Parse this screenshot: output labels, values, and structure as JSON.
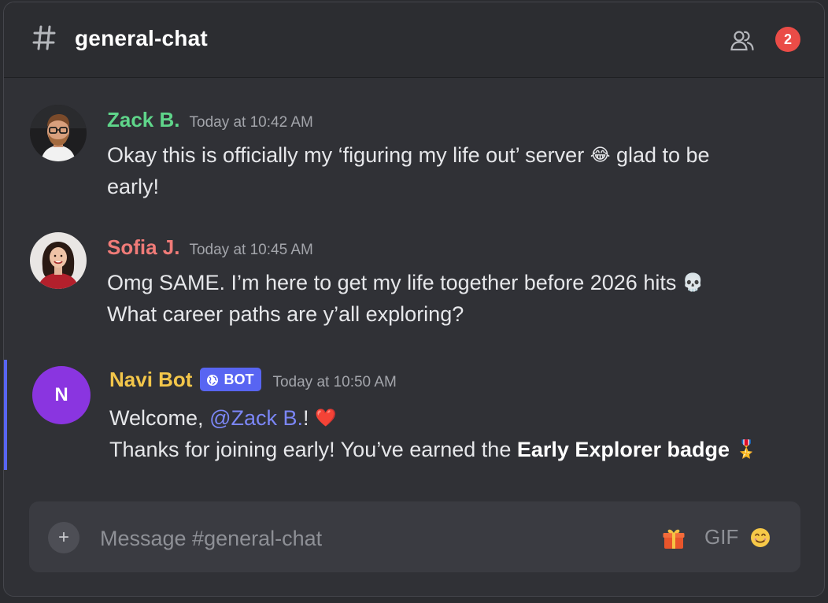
{
  "header": {
    "channel_name": "general-chat",
    "notification_count": "2"
  },
  "messages": [
    {
      "author": "Zack B.",
      "author_color": "#5fd58a",
      "timestamp": "Today at 10:42 AM",
      "line1": "Okay this is officially my ‘figuring my life out’ server",
      "line1_emoji": "😂",
      "line1_tail": "glad to be",
      "line2": "early!"
    },
    {
      "author": "Sofia J.",
      "author_color": "#f07b78",
      "timestamp": "Today at 10:45 AM",
      "line1": "Omg SAME. I’m here to get my life together before 2026 hits",
      "line1_emoji": "💀",
      "line2": "What career paths are y’all exploring?"
    },
    {
      "author": "Navi Bot",
      "author_color": "#f3c64a",
      "avatar_letter": "N",
      "avatar_color": "#8a35e0",
      "bot_tag": "BOT",
      "timestamp": "Today at 10:50 AM",
      "line1_prefix": "Welcome,",
      "mention": "@Zack B.",
      "line1_suffix": "!",
      "line1_emoji": "❤️",
      "line2_prefix": "Thanks for joining early! You’ve earned the",
      "line2_bold": "Early Explorer badge",
      "line2_emoji": "🎖️"
    }
  ],
  "composer": {
    "plus_label": "+",
    "placeholder": "Message #general-chat",
    "gif_label": "GIF"
  },
  "colors": {
    "accent": "#5865f2",
    "badge": "#ea4c47",
    "background": "#303136"
  }
}
